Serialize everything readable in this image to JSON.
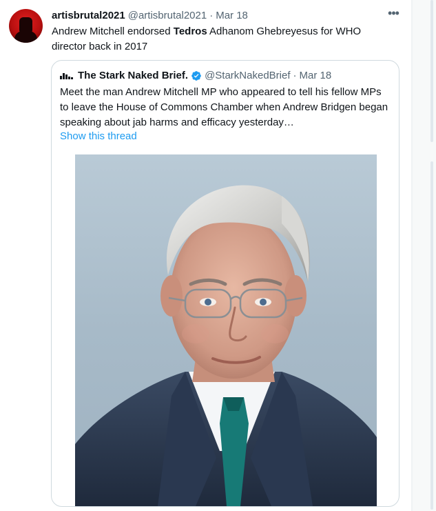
{
  "tweet": {
    "display_name": "artisbrutal2021",
    "handle": "@artisbrutal2021",
    "separator": "·",
    "date": "Mar 18",
    "more_icon": "more-horizontal-icon",
    "text_before": "Andrew Mitchell endorsed ",
    "text_bold": "Tedros",
    "text_after": " Adhanom Ghebreyesus for WHO director back in 2017"
  },
  "quote": {
    "display_name": "The Stark Naked Brief.",
    "handle": "@StarkNakedBrief",
    "separator": "·",
    "date": "Mar 18",
    "verified_icon": "verified-badge-icon",
    "text": "Meet the man Andrew Mitchell MP who appeared to tell his fellow MPs to leave the House of Commons Chamber when Andrew Bridgen began speaking about jab harms and efficacy yesterday…",
    "show_thread": "Show this thread",
    "image": "portrait-photo"
  },
  "colors": {
    "link": "#1d9bf0",
    "secondary_text": "#536471",
    "primary_text": "#0f1419",
    "border": "#cfd9de",
    "verified": "#1d9bf0",
    "avatar_red": "#d01818"
  }
}
